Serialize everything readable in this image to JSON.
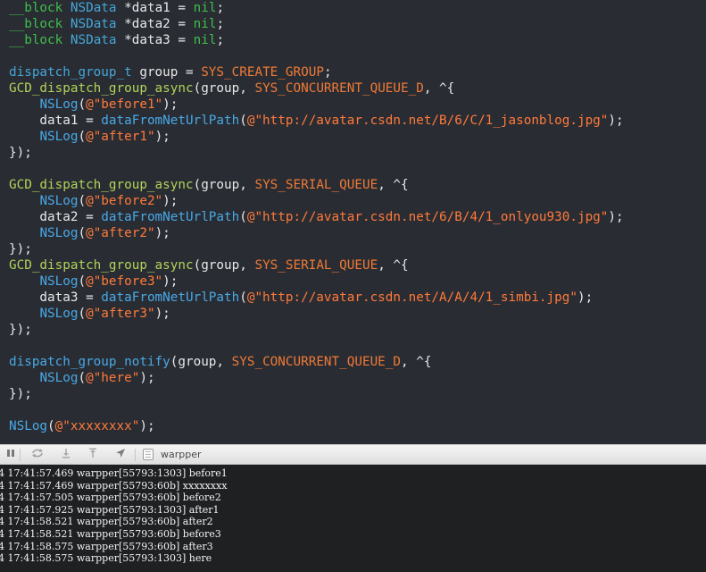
{
  "editor": {
    "lines": [
      [
        {
          "t": "__block",
          "c": "kw"
        },
        {
          "t": " ",
          "c": "plain"
        },
        {
          "t": "NSData",
          "c": "type"
        },
        {
          "t": " *data1 = ",
          "c": "plain"
        },
        {
          "t": "nil",
          "c": "kw"
        },
        {
          "t": ";",
          "c": "plain"
        }
      ],
      [
        {
          "t": "__block",
          "c": "kw"
        },
        {
          "t": " ",
          "c": "plain"
        },
        {
          "t": "NSData",
          "c": "type"
        },
        {
          "t": " *data2 = ",
          "c": "plain"
        },
        {
          "t": "nil",
          "c": "kw"
        },
        {
          "t": ";",
          "c": "plain"
        }
      ],
      [
        {
          "t": "__block",
          "c": "kw"
        },
        {
          "t": " ",
          "c": "plain"
        },
        {
          "t": "NSData",
          "c": "type"
        },
        {
          "t": " *data3 = ",
          "c": "plain"
        },
        {
          "t": "nil",
          "c": "kw"
        },
        {
          "t": ";",
          "c": "plain"
        }
      ],
      [],
      [
        {
          "t": "dispatch_group_t",
          "c": "type"
        },
        {
          "t": " group = ",
          "c": "plain"
        },
        {
          "t": "SYS_CREATE_GROUP",
          "c": "macro"
        },
        {
          "t": ";",
          "c": "plain"
        }
      ],
      [
        {
          "t": "GCD_dispatch_group_async",
          "c": "fn"
        },
        {
          "t": "(group, ",
          "c": "plain"
        },
        {
          "t": "SYS_CONCURRENT_QUEUE_D",
          "c": "macro"
        },
        {
          "t": ", ^{",
          "c": "plain"
        }
      ],
      [
        {
          "t": "    ",
          "c": "plain"
        },
        {
          "t": "NSLog",
          "c": "call"
        },
        {
          "t": "(",
          "c": "plain"
        },
        {
          "t": "@\"before1\"",
          "c": "str"
        },
        {
          "t": ");",
          "c": "plain"
        }
      ],
      [
        {
          "t": "    data1 = ",
          "c": "plain"
        },
        {
          "t": "dataFromNetUrlPath",
          "c": "call"
        },
        {
          "t": "(",
          "c": "plain"
        },
        {
          "t": "@\"http://avatar.csdn.net/B/6/C/1_jasonblog.jpg\"",
          "c": "str"
        },
        {
          "t": ");",
          "c": "plain"
        }
      ],
      [
        {
          "t": "    ",
          "c": "plain"
        },
        {
          "t": "NSLog",
          "c": "call"
        },
        {
          "t": "(",
          "c": "plain"
        },
        {
          "t": "@\"after1\"",
          "c": "str"
        },
        {
          "t": ");",
          "c": "plain"
        }
      ],
      [
        {
          "t": "});",
          "c": "plain"
        }
      ],
      [],
      [
        {
          "t": "GCD_dispatch_group_async",
          "c": "fn"
        },
        {
          "t": "(group, ",
          "c": "plain"
        },
        {
          "t": "SYS_SERIAL_QUEUE",
          "c": "macro"
        },
        {
          "t": ", ^{",
          "c": "plain"
        }
      ],
      [
        {
          "t": "    ",
          "c": "plain"
        },
        {
          "t": "NSLog",
          "c": "call"
        },
        {
          "t": "(",
          "c": "plain"
        },
        {
          "t": "@\"before2\"",
          "c": "str"
        },
        {
          "t": ");",
          "c": "plain"
        }
      ],
      [
        {
          "t": "    data2 = ",
          "c": "plain"
        },
        {
          "t": "dataFromNetUrlPath",
          "c": "call"
        },
        {
          "t": "(",
          "c": "plain"
        },
        {
          "t": "@\"http://avatar.csdn.net/6/B/4/1_onlyou930.jpg\"",
          "c": "str"
        },
        {
          "t": ");",
          "c": "plain"
        }
      ],
      [
        {
          "t": "    ",
          "c": "plain"
        },
        {
          "t": "NSLog",
          "c": "call"
        },
        {
          "t": "(",
          "c": "plain"
        },
        {
          "t": "@\"after2\"",
          "c": "str"
        },
        {
          "t": ");",
          "c": "plain"
        }
      ],
      [
        {
          "t": "});",
          "c": "plain"
        }
      ],
      [
        {
          "t": "GCD_dispatch_group_async",
          "c": "fn"
        },
        {
          "t": "(group, ",
          "c": "plain"
        },
        {
          "t": "SYS_SERIAL_QUEUE",
          "c": "macro"
        },
        {
          "t": ", ^{",
          "c": "plain"
        }
      ],
      [
        {
          "t": "    ",
          "c": "plain"
        },
        {
          "t": "NSLog",
          "c": "call"
        },
        {
          "t": "(",
          "c": "plain"
        },
        {
          "t": "@\"before3\"",
          "c": "str"
        },
        {
          "t": ");",
          "c": "plain"
        }
      ],
      [
        {
          "t": "    data3 = ",
          "c": "plain"
        },
        {
          "t": "dataFromNetUrlPath",
          "c": "call"
        },
        {
          "t": "(",
          "c": "plain"
        },
        {
          "t": "@\"http://avatar.csdn.net/A/A/4/1_simbi.jpg\"",
          "c": "str"
        },
        {
          "t": ");",
          "c": "plain"
        }
      ],
      [
        {
          "t": "    ",
          "c": "plain"
        },
        {
          "t": "NSLog",
          "c": "call"
        },
        {
          "t": "(",
          "c": "plain"
        },
        {
          "t": "@\"after3\"",
          "c": "str"
        },
        {
          "t": ");",
          "c": "plain"
        }
      ],
      [
        {
          "t": "});",
          "c": "plain"
        }
      ],
      [],
      [
        {
          "t": "dispatch_group_notify",
          "c": "call"
        },
        {
          "t": "(group, ",
          "c": "plain"
        },
        {
          "t": "SYS_CONCURRENT_QUEUE_D",
          "c": "macro"
        },
        {
          "t": ", ^{",
          "c": "plain"
        }
      ],
      [
        {
          "t": "    ",
          "c": "plain"
        },
        {
          "t": "NSLog",
          "c": "call"
        },
        {
          "t": "(",
          "c": "plain"
        },
        {
          "t": "@\"here\"",
          "c": "str"
        },
        {
          "t": ");",
          "c": "plain"
        }
      ],
      [
        {
          "t": "});",
          "c": "plain"
        }
      ],
      [],
      [
        {
          "t": "NSLog",
          "c": "call"
        },
        {
          "t": "(",
          "c": "plain"
        },
        {
          "t": "@\"xxxxxxxx\"",
          "c": "str"
        },
        {
          "t": ");",
          "c": "plain"
        }
      ]
    ]
  },
  "toolbar": {
    "icons": [
      "pause-icon",
      "reload-icon",
      "step-over-icon",
      "step-out-icon",
      "location-arrow-icon"
    ],
    "thread_label": "warpper"
  },
  "console": {
    "lines": [
      "4 17:41:57.469 warpper[55793:1303] before1",
      "4 17:41:57.469 warpper[55793:60b] xxxxxxxx",
      "4 17:41:57.505 warpper[55793:60b] before2",
      "4 17:41:57.925 warpper[55793:1303] after1",
      "4 17:41:58.521 warpper[55793:60b] after2",
      "4 17:41:58.521 warpper[55793:60b] before3",
      "4 17:41:58.575 warpper[55793:60b] after3",
      "4 17:41:58.575 warpper[55793:1303] here"
    ]
  },
  "colors": {
    "editor_bg": "#292c33",
    "keyword": "#3fbe4a",
    "type": "#46a6d8",
    "function": "#b2d35a",
    "call": "#48a9e6",
    "macro": "#ef7a36",
    "string": "#ff7a3a",
    "console_bg": "#1f2022"
  }
}
